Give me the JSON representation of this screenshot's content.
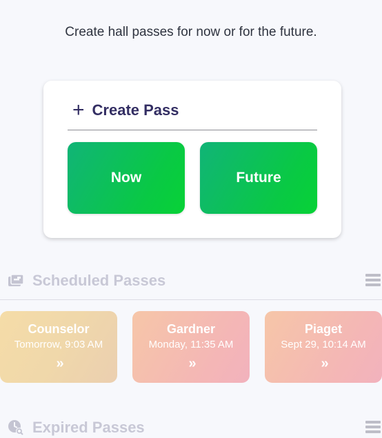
{
  "subtitle": "Create hall passes for now or for the future.",
  "create_pass": {
    "plus_icon": "+",
    "title": "Create Pass",
    "now_label": "Now",
    "future_label": "Future"
  },
  "scheduled": {
    "title": "Scheduled Passes",
    "icon": "scheduled-pass-icon",
    "passes": [
      {
        "name": "Counselor",
        "time": "Tomorrow, 9:03 AM",
        "arrow": "»"
      },
      {
        "name": "Gardner",
        "time": "Monday, 11:35 AM",
        "arrow": "»"
      },
      {
        "name": "Piaget",
        "time": "Sept 29, 10:14 AM",
        "arrow": "»"
      }
    ]
  },
  "expired": {
    "title": "Expired Passes",
    "icon": "expired-pass-icon"
  },
  "colors": {
    "brand_dark": "#332e63",
    "green": "#09c944",
    "muted": "#c8c8d6"
  }
}
